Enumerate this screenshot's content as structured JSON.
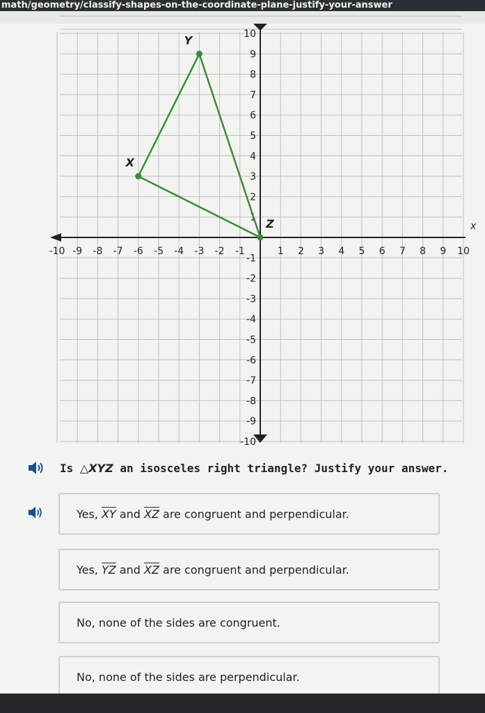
{
  "url": "math/geometry/classify-shapes-on-the-coordinate-plane-justify-your-answer",
  "graph": {
    "x_axis_label": "x",
    "x_ticks": [
      "-10",
      "-9",
      "-8",
      "-7",
      "-6",
      "-5",
      "-4",
      "-3",
      "-2",
      "-1",
      "1",
      "2",
      "3",
      "4",
      "5",
      "6",
      "7",
      "8",
      "9",
      "10"
    ],
    "y_ticks": [
      "10",
      "9",
      "8",
      "7",
      "6",
      "5",
      "4",
      "3",
      "2",
      "1",
      "-1",
      "-2",
      "-3",
      "-4",
      "-5",
      "-6",
      "-7",
      "-8",
      "-9",
      "-10"
    ],
    "points": [
      {
        "label": "X",
        "x": -6,
        "y": 3
      },
      {
        "label": "Y",
        "x": -3,
        "y": 9
      },
      {
        "label": "Z",
        "x": 0,
        "y": 0
      }
    ],
    "line_color": "#3c8a3c",
    "grid_color": "#bfbfbf"
  },
  "question": {
    "prefix": "Is ",
    "triangle": "△XYZ",
    "suffix": " an isosceles right triangle? Justify your answer."
  },
  "choices": [
    {
      "pre": "Yes, ",
      "seg1": "XY",
      "mid": " and ",
      "seg2": "XZ",
      "post": " are congruent and perpendicular."
    },
    {
      "pre": "Yes, ",
      "seg1": "YZ",
      "mid": " and ",
      "seg2": "XZ",
      "post": " are congruent and perpendicular."
    },
    {
      "pre": "No, none of the sides are congruent.",
      "seg1": "",
      "mid": "",
      "seg2": "",
      "post": ""
    },
    {
      "pre": "No, none of the sides are perpendicular.",
      "seg1": "",
      "mid": "",
      "seg2": "",
      "post": ""
    }
  ]
}
